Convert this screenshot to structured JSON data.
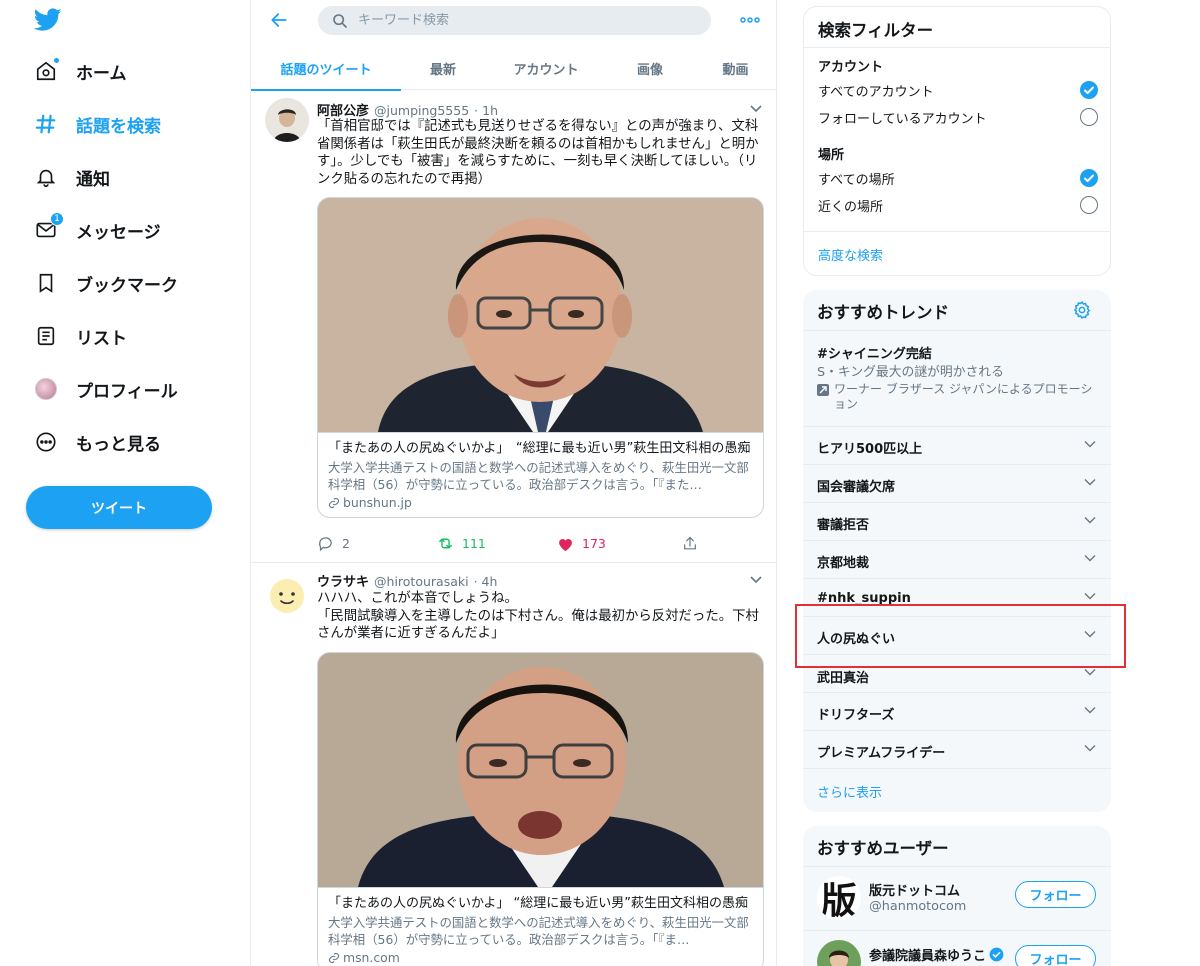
{
  "nav": {
    "items": [
      {
        "label": "ホーム",
        "icon": "home-icon"
      },
      {
        "label": "話題を検索",
        "icon": "hashtag-icon"
      },
      {
        "label": "通知",
        "icon": "bell-icon"
      },
      {
        "label": "メッセージ",
        "icon": "envelope-icon",
        "badge": "1"
      },
      {
        "label": "ブックマーク",
        "icon": "bookmark-icon"
      },
      {
        "label": "リスト",
        "icon": "list-icon"
      },
      {
        "label": "プロフィール",
        "icon": "avatar"
      },
      {
        "label": "もっと見る",
        "icon": "more-circle-icon"
      }
    ],
    "tweet_button": "ツイート"
  },
  "search": {
    "placeholder": "キーワード検索"
  },
  "tabs": [
    "話題のツイート",
    "最新",
    "アカウント",
    "画像",
    "動画"
  ],
  "tweets": [
    {
      "name": "阿部公彦",
      "handle": "@jumping5555",
      "time": "· 1h",
      "text": "「首相官邸では『記述式も見送りせざるを得ない』との声が強まり、文科省関係者は「萩生田氏が最終決断を頼るのは首相かもしれません」と明かす」。少しでも「被害」を減らすために、一刻も早く決断してほしい。（リンク貼るの忘れたので再掲）",
      "card_title": "「またあの人の尻ぬぐいかよ」　“総理に最も近い男”萩生田文科相の愚痴",
      "card_desc": "大学入学共通テストの国語と数学への記述式導入をめぐり、萩生田光一文部科学相（56）が守勢に立っている。政治部デスクは言う。「『また…",
      "card_domain": "bunshun.jp",
      "replies": "2",
      "retweets": "111",
      "likes": "173"
    },
    {
      "name": "ウラサキ",
      "handle": "@hirotourasaki",
      "time": "· 4h",
      "text": "ハハハ、これが本音でしょうね。\n「民間試験導入を主導したのは下村さん。俺は最初から反対だった。下村さんが業者に近すぎるんだよ」",
      "card_title": "「またあの人の尻ぬぐいかよ」 “総理に最も近い男”萩生田文科相の愚痴",
      "card_desc": "大学入学共通テストの国語と数学への記述式導入をめぐり、萩生田光一文部科学相（56）が守勢に立っている。政治部デスクは言う。「『ま…",
      "card_domain": "msn.com"
    }
  ],
  "filters": {
    "title": "検索フィルター",
    "account_section": "アカウント",
    "account_options": [
      "すべてのアカウント",
      "フォローしているアカウント"
    ],
    "place_section": "場所",
    "place_options": [
      "すべての場所",
      "近くの場所"
    ],
    "advanced": "高度な検索"
  },
  "trends": {
    "title": "おすすめトレンド",
    "promoted": {
      "name": "#シャイニング完結",
      "desc": "S・キング最大の謎が明かされる",
      "promo": "ワーナー ブラザース ジャパンによるプロモーション"
    },
    "items": [
      "ヒアリ500匹以上",
      "国会審議欠席",
      "審議拒否",
      "京都地裁",
      "#nhk_suppin",
      "人の尻ぬぐい",
      "武田真治",
      "ドリフターズ",
      "プレミアムフライデー"
    ],
    "show_more": "さらに表示"
  },
  "users": {
    "title": "おすすめユーザー",
    "list": [
      {
        "name": "版元ドットコム",
        "handle": "@hanmotocom",
        "follow": "フォロー",
        "avatar_text": "版"
      },
      {
        "name": "参議院議員森ゆうこ",
        "handle": "",
        "follow": "フォロー"
      }
    ]
  },
  "colors": {
    "accent": "#1da1f2",
    "retweet": "#17bf63",
    "like": "#e0245e",
    "highlight": "#e0303a"
  }
}
